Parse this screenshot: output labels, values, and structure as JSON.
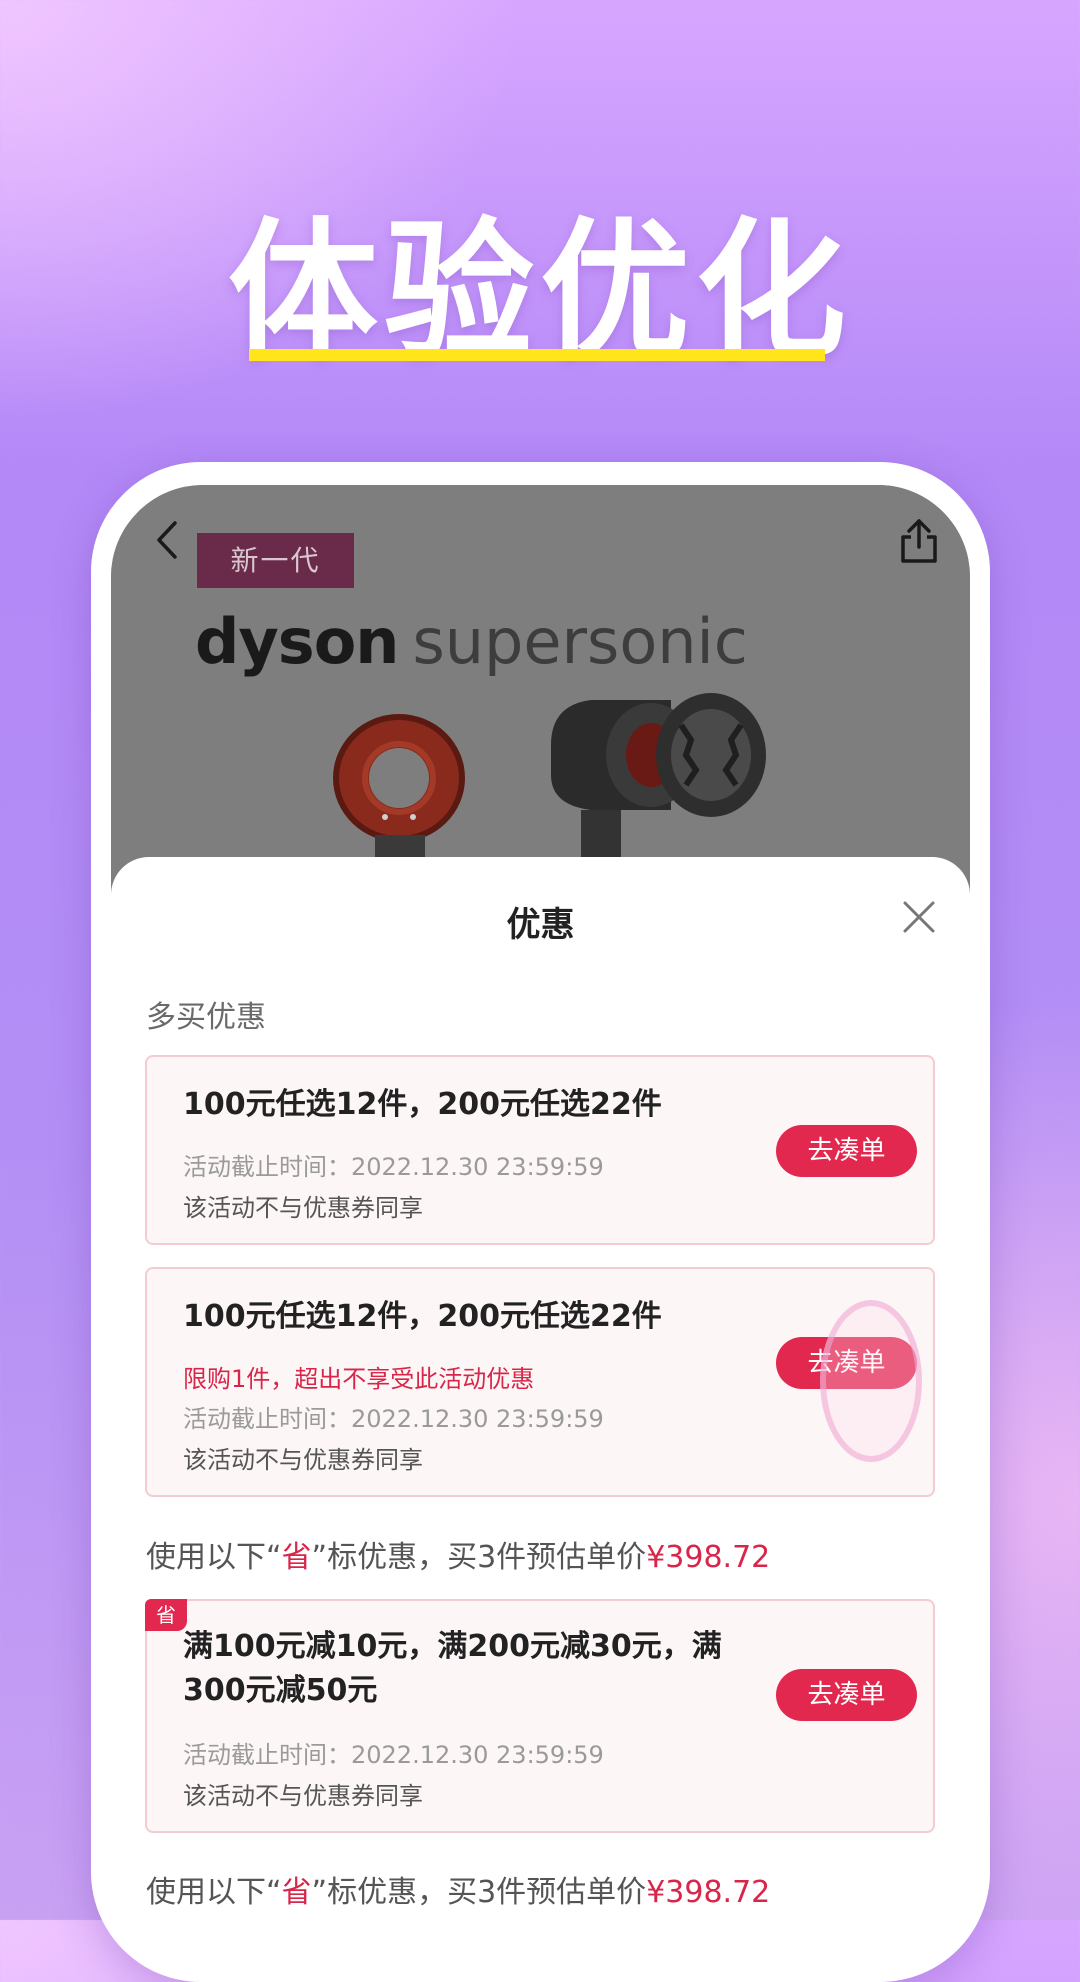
{
  "headline": "体验优化",
  "product": {
    "badge": "新一代",
    "brand": "dyson",
    "model": "supersonic"
  },
  "sheet": {
    "title": "优惠",
    "section_label": "多买优惠",
    "cards": [
      {
        "title": "100元任选12件，200元任选22件",
        "deadline": "活动截止时间：2022.12.30 23:59:59",
        "note": "该活动不与优惠券同享",
        "cta": "去凑单"
      },
      {
        "title": "100元任选12件，200元任选22件",
        "limit": "限购1件，超出不享受此活动优惠",
        "deadline": "活动截止时间：2022.12.30 23:59:59",
        "note": "该活动不与优惠券同享",
        "cta": "去凑单"
      }
    ],
    "estimate_1": {
      "prefix": "使用以下“",
      "mark": "省",
      "suffix": "”标优惠，买3件预估单价",
      "price": "¥398.72"
    },
    "save_card": {
      "tag": "省",
      "title": "满100元减10元，满200元减30元，满300元减50元",
      "deadline": "活动截止时间：2022.12.30 23:59:59",
      "note": "该活动不与优惠券同享",
      "cta": "去凑单"
    },
    "estimate_2": {
      "prefix": "使用以下“",
      "mark": "省",
      "suffix": "”标优惠，买3件预估单价",
      "price": "¥398.72"
    }
  },
  "colors": {
    "accent": "#e3284f",
    "highlight": "#ffe51a",
    "card_border": "#f3cbd1",
    "card_bg": "#fdf6f7"
  },
  "icons": [
    "back-arrow-icon",
    "share-icon",
    "close-icon"
  ]
}
